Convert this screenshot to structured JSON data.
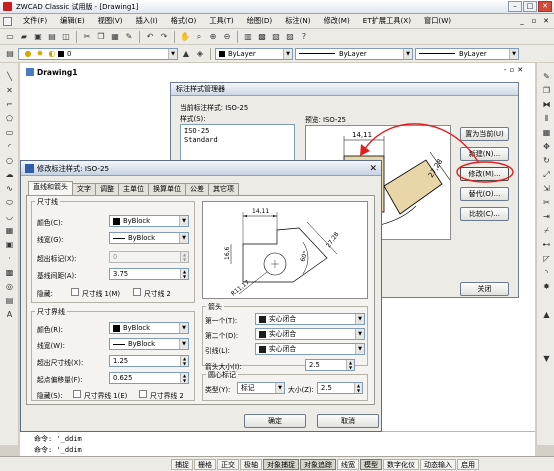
{
  "window": {
    "title": "ZWCAD Classic 试用版 - [Drawing1]",
    "min": "–",
    "max": "□",
    "close": "✕"
  },
  "menu": [
    "文件(F)",
    "编辑(E)",
    "视图(V)",
    "插入(I)",
    "格式(O)",
    "工具(T)",
    "绘图(D)",
    "标注(N)",
    "修改(M)",
    "ET扩展工具(X)",
    "窗口(W)"
  ],
  "mdi": {
    "min": "_",
    "restore": "▫",
    "close": "✕"
  },
  "toolbar": {
    "layer_value": "0",
    "color_value": "ByLayer",
    "linetype_value": "ByLayer",
    "lineweight_value": "ByLayer"
  },
  "drawing": {
    "tab": "Drawing1",
    "ctrl_min": "-",
    "ctrl_restore": "▫",
    "ctrl_close": "✕"
  },
  "command": {
    "line1": "命令: '_ddim",
    "line2": "命令: '_ddim"
  },
  "status": {
    "coords": "",
    "buttons": [
      "捕捉",
      "栅格",
      "正交",
      "极轴",
      "对象捕捉",
      "对象追踪",
      "线宽",
      "模型",
      "数字化仪",
      "动态输入",
      "启用"
    ]
  },
  "manager": {
    "title": "标注样式管理器",
    "current_label": "当前标注样式: ISO-25",
    "styles_label": "样式(S):",
    "styles": [
      "ISO-25",
      "Standard"
    ],
    "preview_label": "预览: ISO-25",
    "buttons": [
      "置为当前(U)",
      "新建(N)...",
      "修改(M)...",
      "替代(O)...",
      "比较(C)..."
    ],
    "close": "关闭",
    "dim_top": "14,11",
    "dim_side": "27,28"
  },
  "modify": {
    "title": "修改标注样式: ISO-25",
    "tabs": [
      "直线和箭头",
      "文字",
      "调整",
      "主单位",
      "换算单位",
      "公差",
      "其它项"
    ],
    "dimline": {
      "title": "尺寸线",
      "color_label": "颜色(C):",
      "color_value": "ByBlock",
      "lineweight_label": "线宽(G):",
      "lineweight_value": "ByBlock",
      "extend_label": "超出标记(X):",
      "extend_value": "0",
      "baseline_label": "基线间距(A):",
      "baseline_value": "3.75",
      "suppress_label": "隐藏:",
      "sup1": "尺寸线 1(M)",
      "sup2": "尺寸线 2"
    },
    "extline": {
      "title": "尺寸界线",
      "color_label": "颜色(R):",
      "color_value": "ByBlock",
      "lineweight_label": "线宽(W):",
      "lineweight_value": "ByBlock",
      "extend_label": "超出尺寸线(X):",
      "extend_value": "1.25",
      "offset_label": "起点偏移量(F):",
      "offset_value": "0.625",
      "suppress_label": "隐藏(S):",
      "sup1": "尺寸界线 1(E)",
      "sup2": "尺寸界线 2"
    },
    "arrows": {
      "title": "箭头",
      "first_label": "第一个(T):",
      "first_value": "实心闭合",
      "second_label": "第二个(D):",
      "second_value": "实心闭合",
      "leader_label": "引线(L):",
      "leader_value": "实心闭合",
      "size_label": "箭头大小(I):",
      "size_value": "2.5"
    },
    "center": {
      "title": "圆心标记",
      "type_label": "类型(Y):",
      "type_value": "标记",
      "size_label": "大小(Z):",
      "size_value": "2.5"
    },
    "preview": {
      "top": "14,11",
      "left": "16,6",
      "right": "27,28",
      "angle": "60°",
      "radius": "R11,17"
    },
    "ok": "确定",
    "cancel": "取消"
  }
}
